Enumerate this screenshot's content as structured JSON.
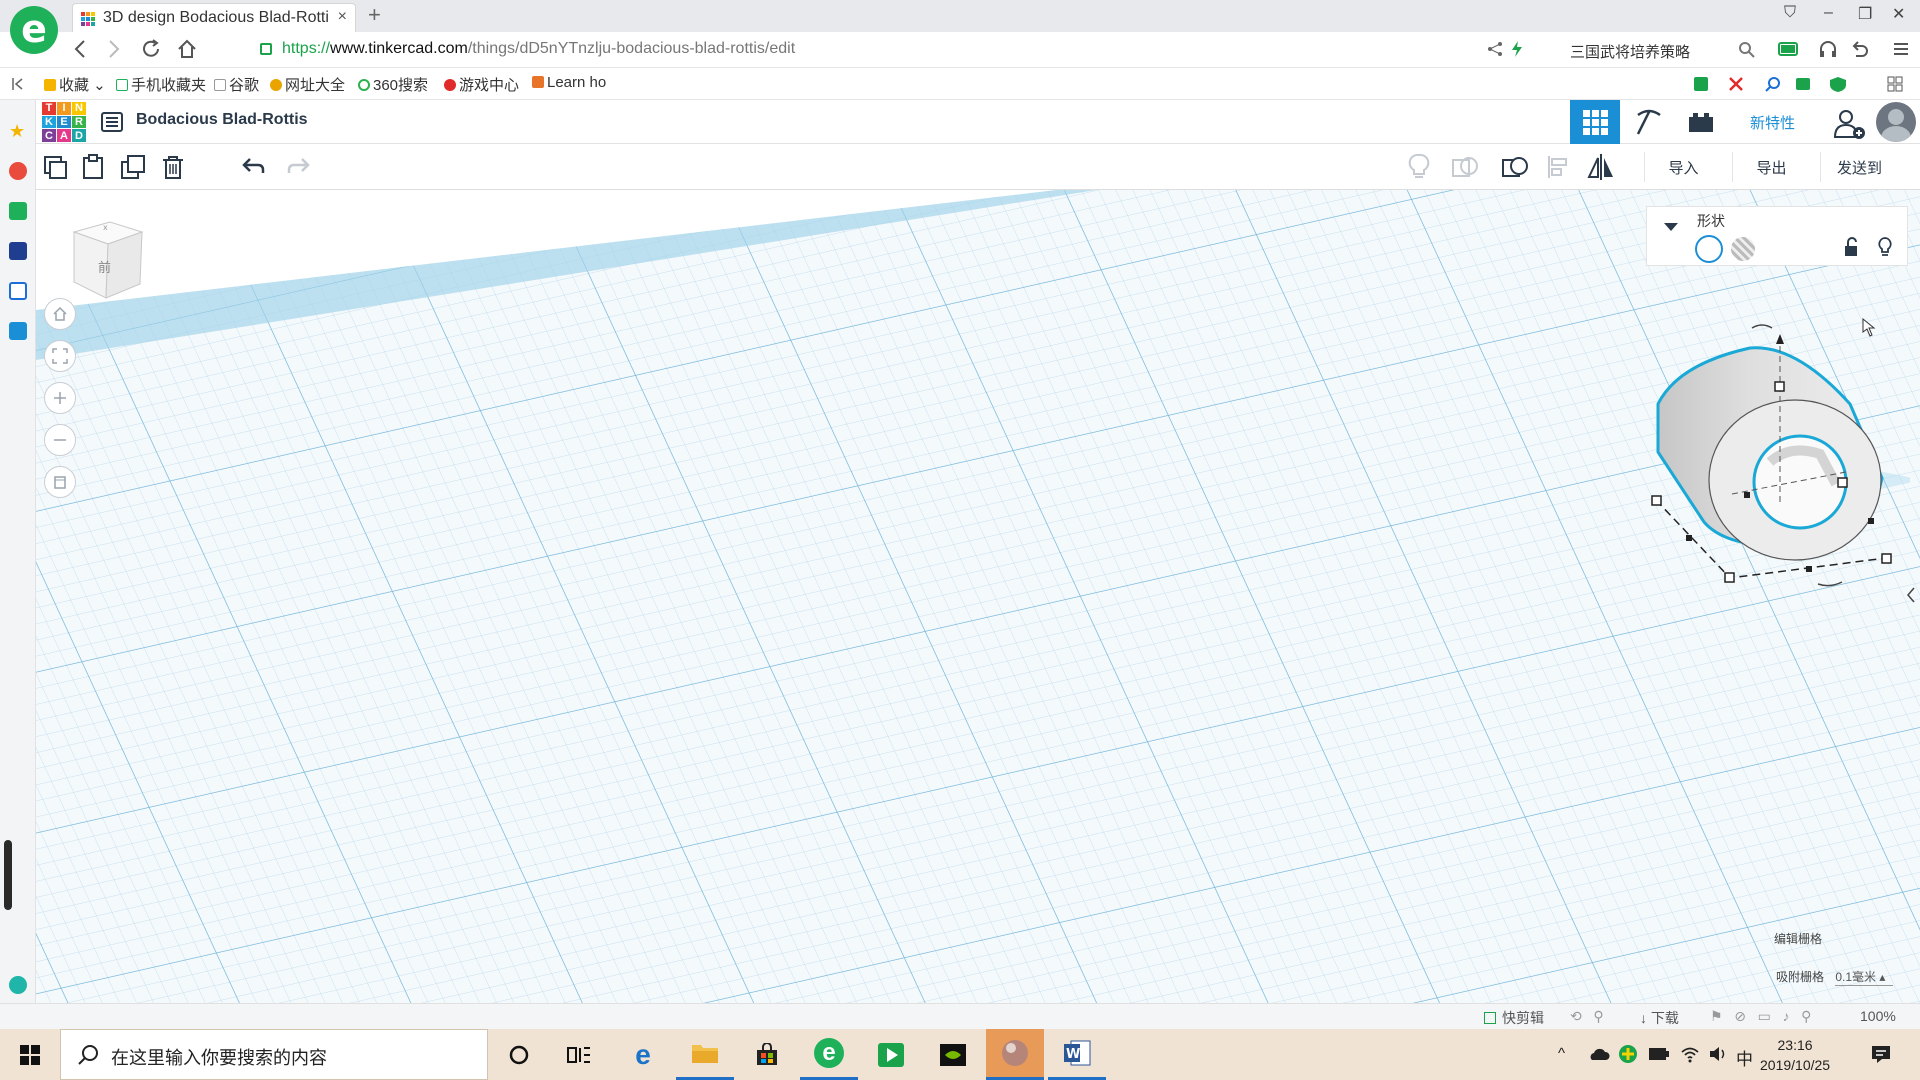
{
  "browser": {
    "tab_title": "3D design Bodacious Blad-Rotti",
    "tab_close": "×",
    "new_tab": "+",
    "url_scheme": "https://",
    "url_domain": "www.tinkercad.com",
    "url_path": "/things/dD5nYTnzlju-bodacious-blad-rottis/edit",
    "search_text": "三国武将培养策略",
    "logo_letter": "e",
    "window": {
      "minimize": "–",
      "restore": "❐",
      "close": "✕",
      "pin": "⛉"
    }
  },
  "bookmarks": [
    {
      "label": "收藏",
      "color": "#f5b400"
    },
    {
      "label": "手机收藏夹",
      "color": "#1fb05a"
    },
    {
      "label": "谷歌",
      "color": "#999999"
    },
    {
      "label": "网址大全",
      "color": "#e9a400"
    },
    {
      "label": "360搜索",
      "color": "#2bb24c"
    },
    {
      "label": "游戏中心",
      "color": "#e02b2b"
    },
    {
      "label": "Learn ho",
      "color": "#e8742a"
    }
  ],
  "app": {
    "logo_letters": [
      "T",
      "I",
      "N",
      "K",
      "E",
      "R",
      "C",
      "A",
      "D"
    ],
    "logo_colors": [
      "#e53a2f",
      "#f39a1e",
      "#f8c700",
      "#1ea3dd",
      "#1f8bd0",
      "#37b34a",
      "#7d3f98",
      "#e4388a",
      "#1aa6a6"
    ],
    "design_title": "Bodacious Blad-Rottis",
    "new_features": "新特性",
    "import": "导入",
    "export": "导出",
    "send_to": "发送到",
    "viewcube_label": "前",
    "inspector_title": "形状",
    "edit_grid": "编辑栅格",
    "snap_grid": "吸附栅格",
    "snap_value": "0.1毫米",
    "accent": "#1b8fd6"
  },
  "statusbar": {
    "quick_edit": "快剪辑",
    "download": "下载",
    "zoom": "100%"
  },
  "taskbar": {
    "search_placeholder": "在这里输入你要搜索的内容",
    "time": "23:16",
    "date": "2019/10/25",
    "ime": "中"
  }
}
